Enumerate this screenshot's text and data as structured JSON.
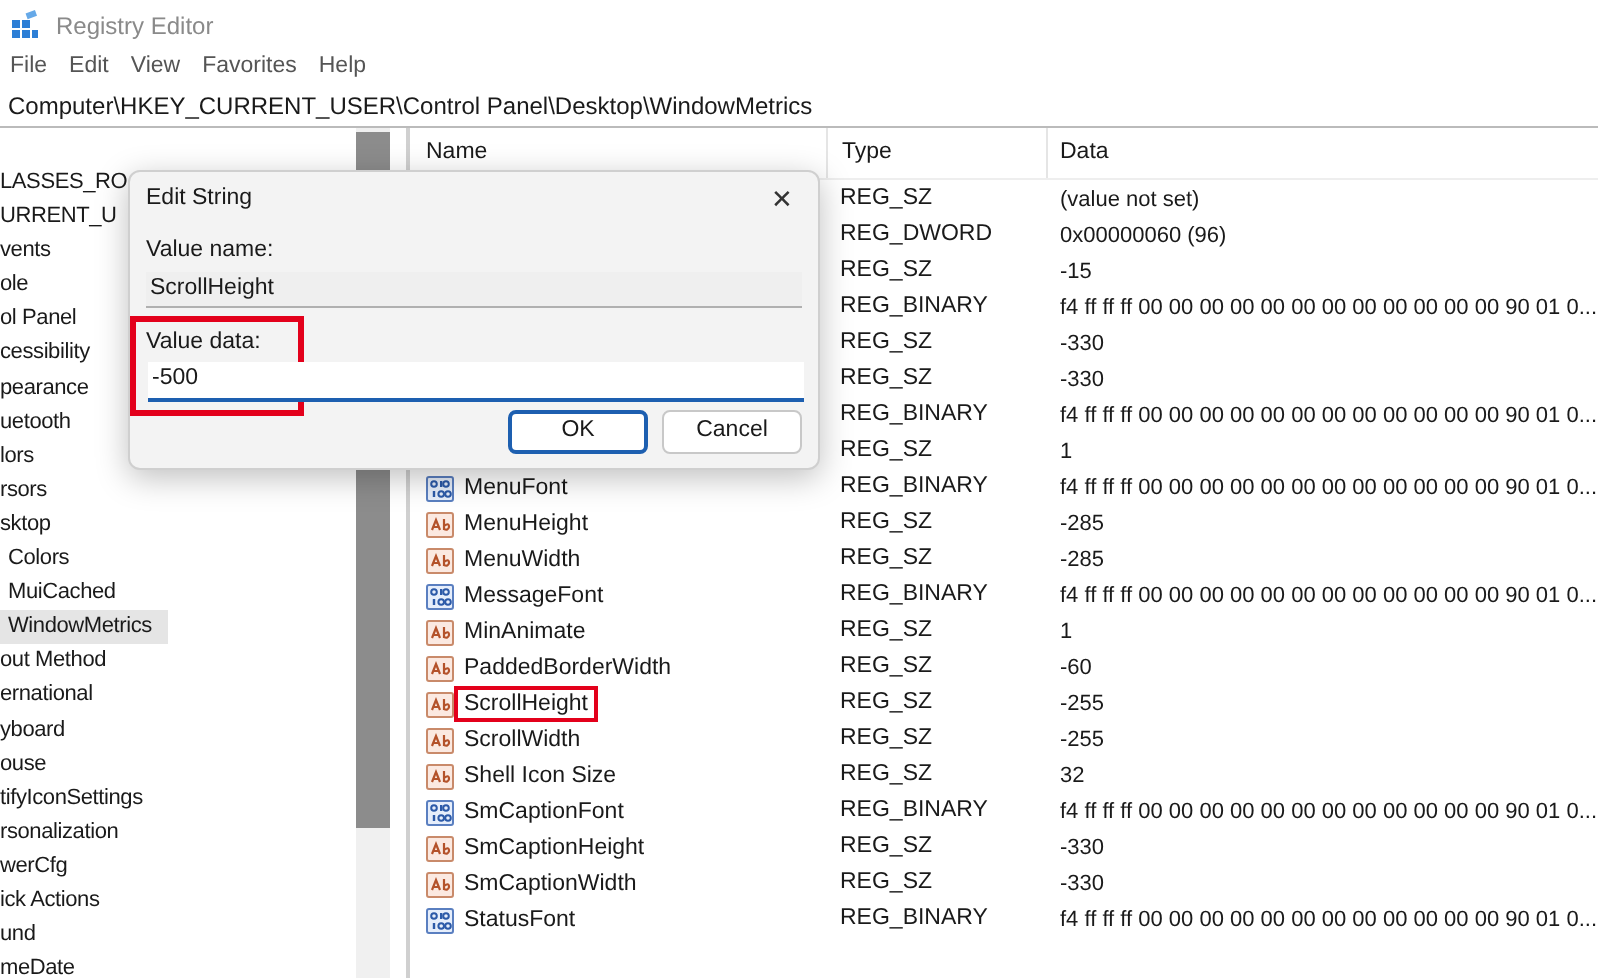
{
  "window": {
    "title": "Registry Editor"
  },
  "menu": [
    "File",
    "Edit",
    "View",
    "Favorites",
    "Help"
  ],
  "address": "Computer\\HKEY_CURRENT_USER\\Control Panel\\Desktop\\WindowMetrics",
  "tree": [
    {
      "label": "LASSES_RO",
      "selected": false
    },
    {
      "label": "URRENT_U",
      "selected": false
    },
    {
      "label": "vents",
      "selected": false
    },
    {
      "label": "ole",
      "selected": false
    },
    {
      "label": "ol Panel",
      "selected": false
    },
    {
      "label": "cessibility",
      "selected": false
    },
    {
      "label": "pearance",
      "selected": false
    },
    {
      "label": "uetooth",
      "selected": false
    },
    {
      "label": "lors",
      "selected": false
    },
    {
      "label": "rsors",
      "selected": false
    },
    {
      "label": "sktop",
      "selected": false,
      "children": [
        {
          "label": "Colors",
          "selected": false
        },
        {
          "label": "MuiCached",
          "selected": false
        },
        {
          "label": "WindowMetrics",
          "selected": true
        }
      ]
    },
    {
      "label": "out Method",
      "selected": false
    },
    {
      "label": "ernational",
      "selected": false
    },
    {
      "label": "yboard",
      "selected": false
    },
    {
      "label": "ouse",
      "selected": false
    },
    {
      "label": "tifyIconSettings",
      "selected": false
    },
    {
      "label": "rsonalization",
      "selected": false
    },
    {
      "label": "werCfg",
      "selected": false
    },
    {
      "label": "ick Actions",
      "selected": false
    },
    {
      "label": "und",
      "selected": false
    },
    {
      "label": "meDate",
      "selected": false
    }
  ],
  "table": {
    "columns": [
      "Name",
      "Type",
      "Data"
    ],
    "rows": [
      {
        "type": "REG_SZ",
        "data": "(value not set)"
      },
      {
        "type": "REG_DWORD",
        "data": "0x00000060 (96)"
      },
      {
        "type": "REG_SZ",
        "data": "-15"
      },
      {
        "type": "REG_BINARY",
        "data": "f4 ff ff ff 00 00 00 00 00 00 00 00 00 00 00 00 90 01 0..."
      },
      {
        "type": "REG_SZ",
        "data": "-330"
      },
      {
        "type": "REG_SZ",
        "data": "-330"
      },
      {
        "type": "REG_BINARY",
        "data": "f4 ff ff ff 00 00 00 00 00 00 00 00 00 00 00 00 90 01 0..."
      },
      {
        "type": "REG_SZ",
        "data": "1"
      },
      {
        "kind": "binary",
        "name": "MenuFont",
        "type": "REG_BINARY",
        "data": "f4 ff ff ff 00 00 00 00 00 00 00 00 00 00 00 00 90 01 0...",
        "selected": false
      },
      {
        "kind": "string",
        "name": "MenuHeight",
        "type": "REG_SZ",
        "data": "-285",
        "selected": false
      },
      {
        "kind": "string",
        "name": "MenuWidth",
        "type": "REG_SZ",
        "data": "-285",
        "selected": false
      },
      {
        "kind": "binary",
        "name": "MessageFont",
        "type": "REG_BINARY",
        "data": "f4 ff ff ff 00 00 00 00 00 00 00 00 00 00 00 00 90 01 0...",
        "selected": false
      },
      {
        "kind": "string",
        "name": "MinAnimate",
        "type": "REG_SZ",
        "data": "1",
        "selected": false
      },
      {
        "kind": "string",
        "name": "PaddedBorderWidth",
        "type": "REG_SZ",
        "data": "-60",
        "selected": false
      },
      {
        "kind": "string",
        "name": "ScrollHeight",
        "type": "REG_SZ",
        "data": "-255",
        "selected": true
      },
      {
        "kind": "string",
        "name": "ScrollWidth",
        "type": "REG_SZ",
        "data": "-255",
        "selected": false
      },
      {
        "kind": "string",
        "name": "Shell Icon Size",
        "type": "REG_SZ",
        "data": "32",
        "selected": false
      },
      {
        "kind": "binary",
        "name": "SmCaptionFont",
        "type": "REG_BINARY",
        "data": "f4 ff ff ff 00 00 00 00 00 00 00 00 00 00 00 00 90 01 0...",
        "selected": false
      },
      {
        "kind": "string",
        "name": "SmCaptionHeight",
        "type": "REG_SZ",
        "data": "-330",
        "selected": false
      },
      {
        "kind": "string",
        "name": "SmCaptionWidth",
        "type": "REG_SZ",
        "data": "-330",
        "selected": false
      },
      {
        "kind": "binary",
        "name": "StatusFont",
        "type": "REG_BINARY",
        "data": "f4 ff ff ff 00 00 00 00 00 00 00 00 00 00 00 00 90 01 0...",
        "selected": false
      }
    ]
  },
  "dialog": {
    "title": "Edit String",
    "close": "✕",
    "name_label": "Value name:",
    "name_value": "ScrollHeight",
    "data_label": "Value data:",
    "data_value": "-500",
    "buttons": [
      {
        "label": "OK",
        "default": true
      },
      {
        "label": "Cancel",
        "default": false
      }
    ]
  }
}
